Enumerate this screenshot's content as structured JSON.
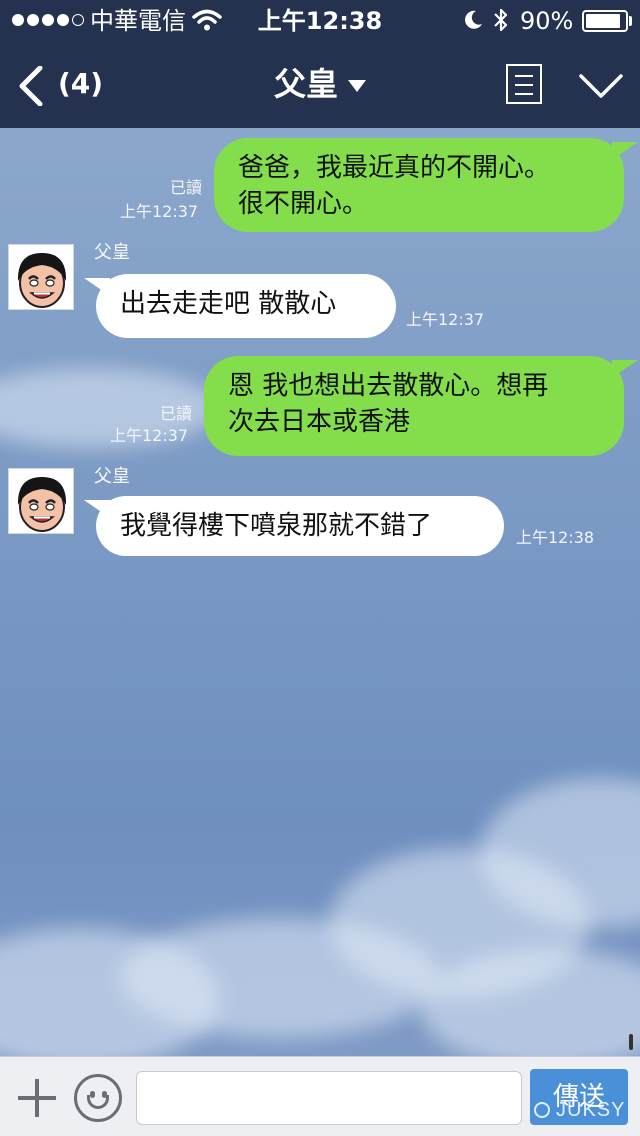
{
  "status_bar": {
    "signal_bars": 5,
    "signal_filled": 4,
    "carrier": "中華電信",
    "time": "上午12:38",
    "battery_percent": "90%",
    "battery_level": 0.9,
    "icons": [
      "wifi-icon",
      "moon-icon",
      "bluetooth-icon",
      "battery-icon"
    ]
  },
  "nav": {
    "back_count": "(4)",
    "title": "父皇",
    "icons": [
      "back-arrow-icon",
      "dropdown-caret-icon",
      "menu-icon",
      "chevron-down-icon"
    ]
  },
  "messages": [
    {
      "type": "sent",
      "lines": [
        "爸爸，我最近真的不開心。",
        "很不開心。"
      ],
      "read": "已讀",
      "time": "上午12:37"
    },
    {
      "type": "received",
      "sender": "父皇",
      "lines": [
        "出去走走吧 散散心"
      ],
      "time": "上午12:37"
    },
    {
      "type": "sent",
      "lines": [
        "恩 我也想出去散散心。想再",
        "次去日本或香港"
      ],
      "read": "已讀",
      "time": "上午12:37"
    },
    {
      "type": "received",
      "sender": "父皇",
      "lines": [
        "我覺得樓下噴泉那就不錯了"
      ],
      "time": "上午12:38"
    }
  ],
  "input_bar": {
    "input_value": "",
    "send_label": "傳送",
    "icons": [
      "plus-icon",
      "emoji-icon"
    ]
  },
  "watermark": "JUKSY",
  "colors": {
    "bar_background": "#24324f",
    "sent_bubble": "#84dd4a",
    "received_bubble": "#ffffff",
    "send_button": "#4a90d9"
  }
}
